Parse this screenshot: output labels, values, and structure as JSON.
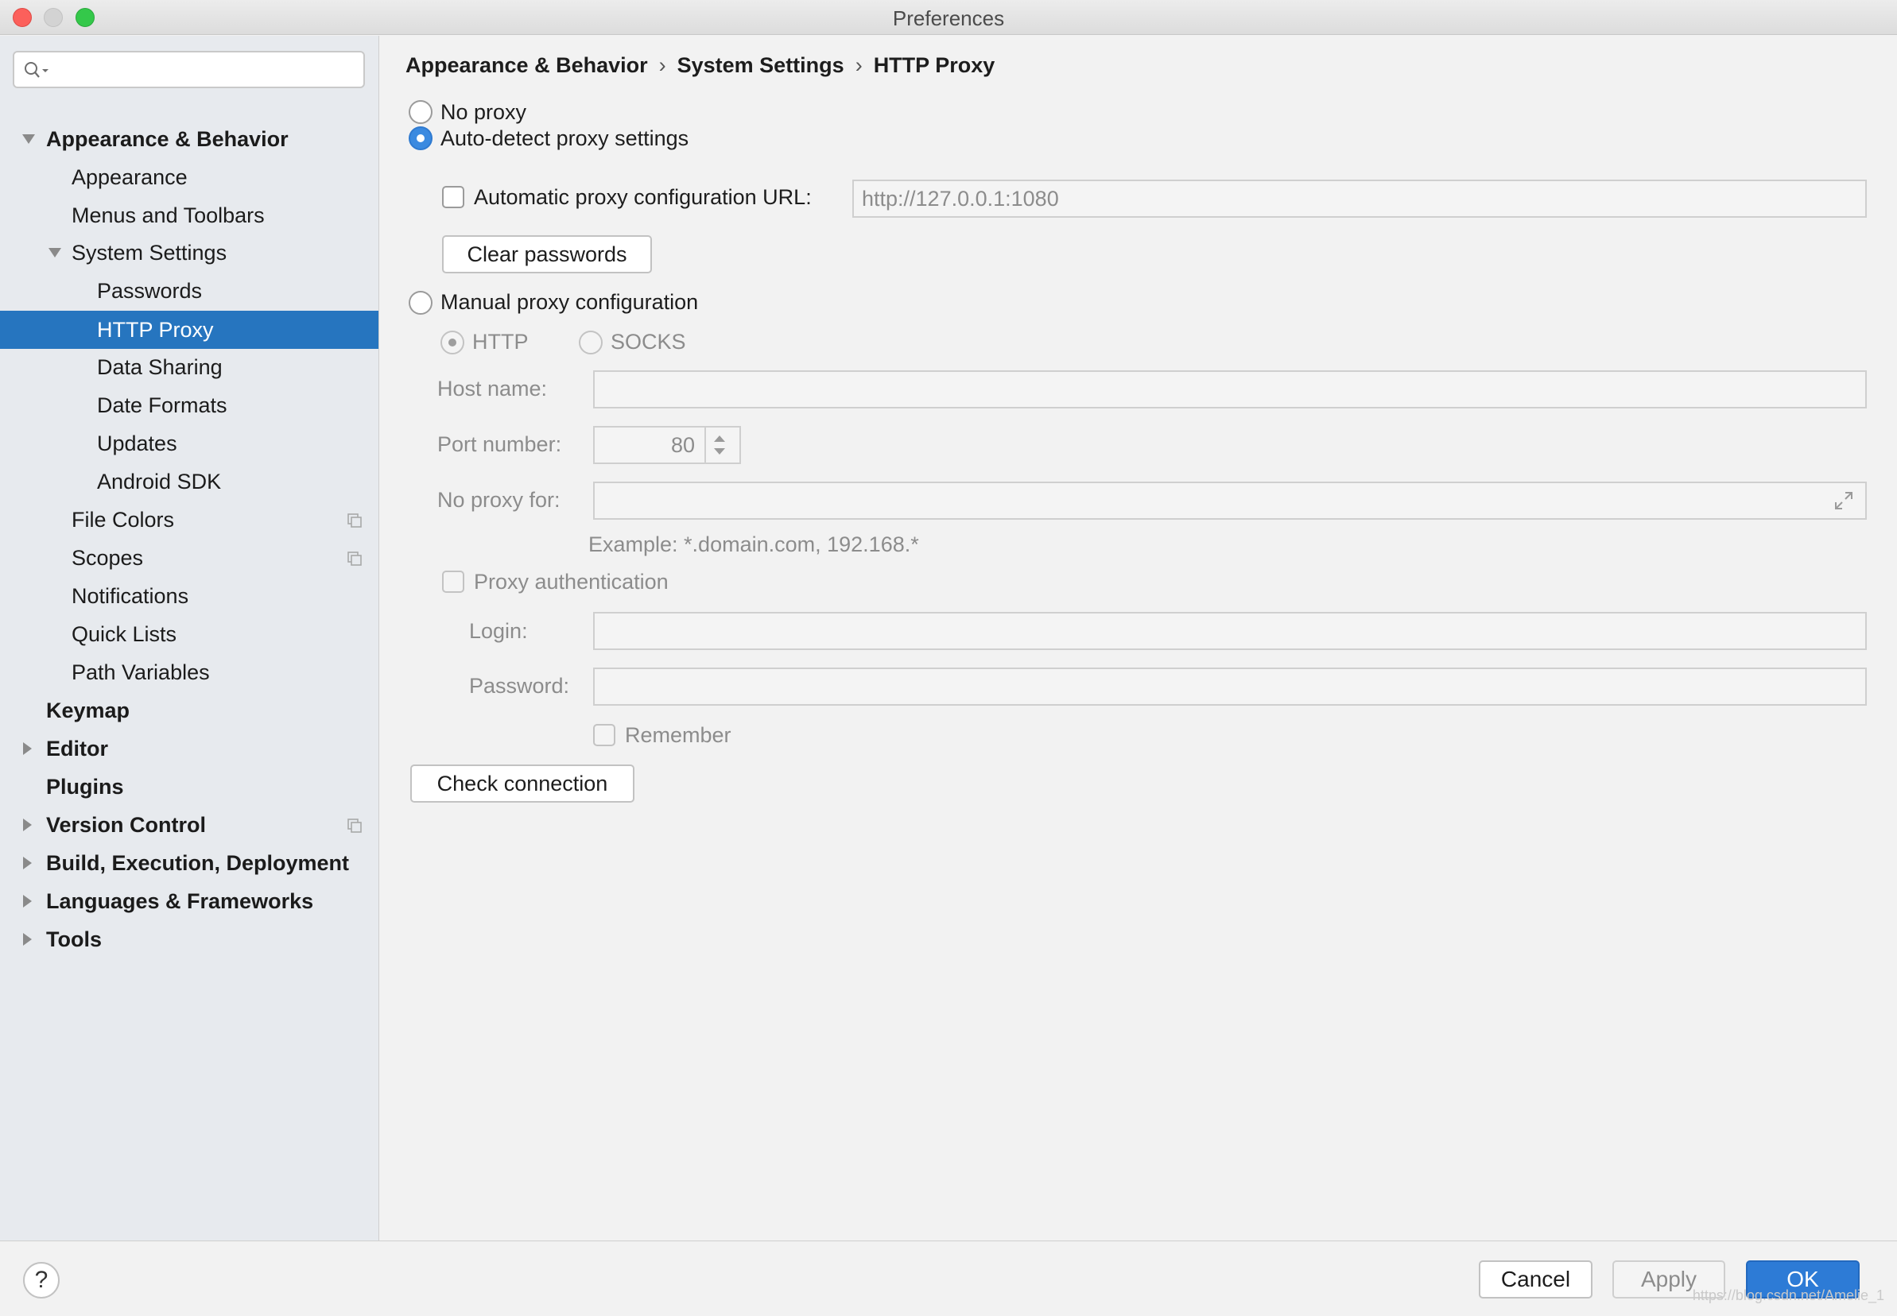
{
  "window": {
    "title": "Preferences"
  },
  "search": {
    "placeholder": ""
  },
  "sidebar": {
    "items": [
      {
        "label": "Appearance & Behavior"
      },
      {
        "label": "Appearance"
      },
      {
        "label": "Menus and Toolbars"
      },
      {
        "label": "System Settings"
      },
      {
        "label": "Passwords"
      },
      {
        "label": "HTTP Proxy"
      },
      {
        "label": "Data Sharing"
      },
      {
        "label": "Date Formats"
      },
      {
        "label": "Updates"
      },
      {
        "label": "Android SDK"
      },
      {
        "label": "File Colors"
      },
      {
        "label": "Scopes"
      },
      {
        "label": "Notifications"
      },
      {
        "label": "Quick Lists"
      },
      {
        "label": "Path Variables"
      },
      {
        "label": "Keymap"
      },
      {
        "label": "Editor"
      },
      {
        "label": "Plugins"
      },
      {
        "label": "Version Control"
      },
      {
        "label": "Build, Execution, Deployment"
      },
      {
        "label": "Languages & Frameworks"
      },
      {
        "label": "Tools"
      }
    ]
  },
  "breadcrumb": {
    "items": [
      "Appearance & Behavior",
      "System Settings",
      "HTTP Proxy"
    ],
    "separator": "›"
  },
  "proxy": {
    "no_proxy_label": "No proxy",
    "auto_detect_label": "Auto-detect proxy settings",
    "auto_url_label": "Automatic proxy configuration URL:",
    "auto_url_value": "http://127.0.0.1:1080",
    "clear_passwords_label": "Clear passwords",
    "manual_label": "Manual proxy configuration",
    "http_label": "HTTP",
    "socks_label": "SOCKS",
    "host_label": "Host name:",
    "host_value": "",
    "port_label": "Port number:",
    "port_value": "80",
    "no_proxy_for_label": "No proxy for:",
    "no_proxy_for_value": "",
    "example_text": "Example: *.domain.com, 192.168.*",
    "auth_label": "Proxy authentication",
    "login_label": "Login:",
    "login_value": "",
    "password_label": "Password:",
    "password_value": "",
    "remember_label": "Remember",
    "check_connection_label": "Check connection"
  },
  "footer": {
    "help_label": "?",
    "cancel_label": "Cancel",
    "apply_label": "Apply",
    "ok_label": "OK",
    "watermark": "https://blog.csdn.net/Amelie_1"
  },
  "colors": {
    "selection": "#2675bf",
    "ok_button": "#2d7bd6",
    "radio_checked": "#3b8ae0"
  }
}
